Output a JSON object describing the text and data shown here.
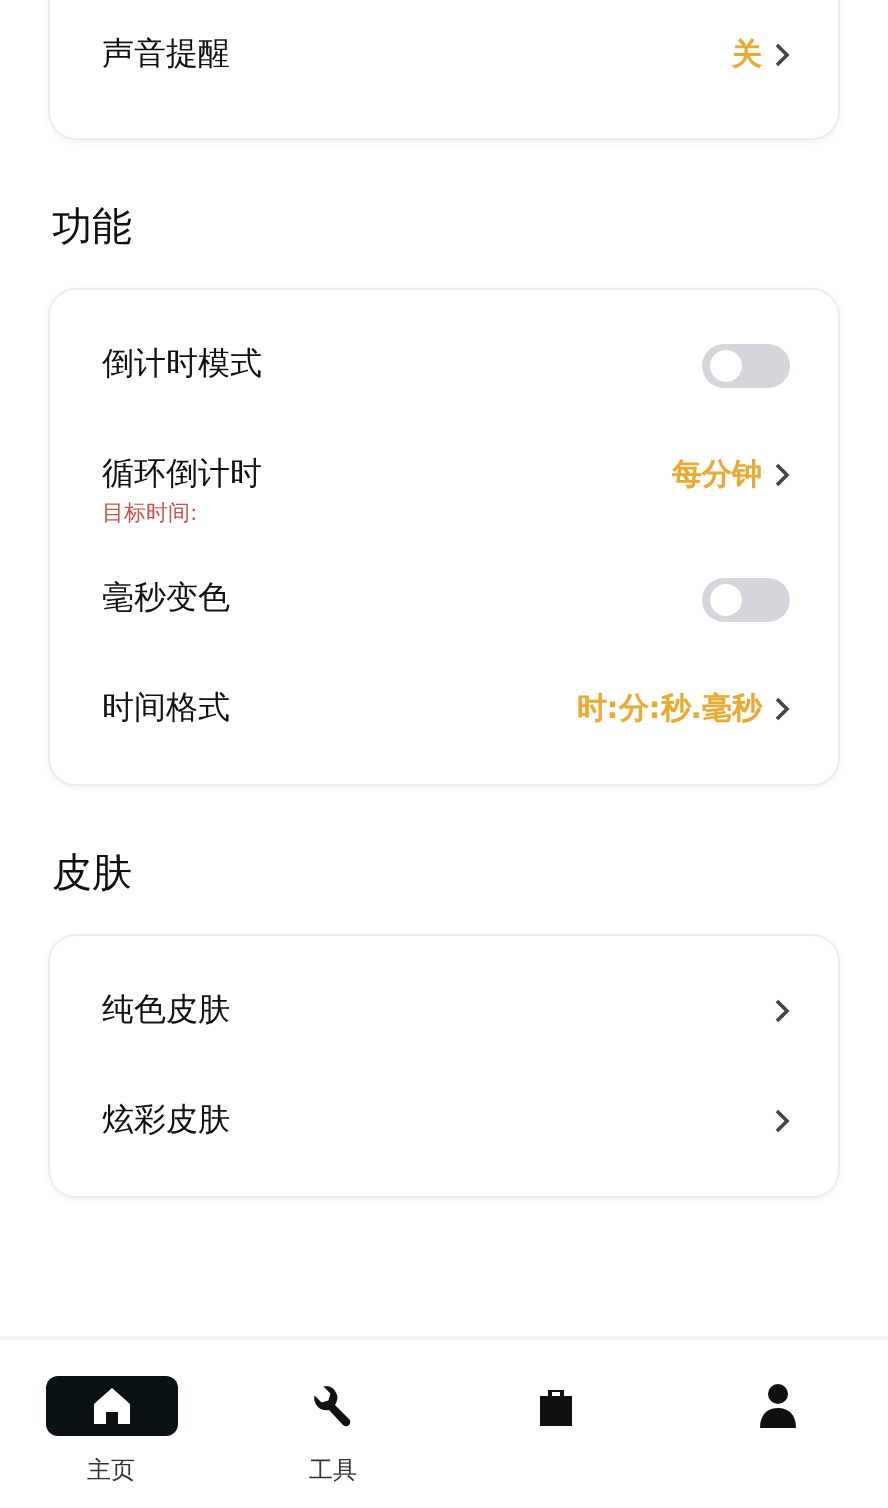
{
  "sections": [
    {
      "rows": [
        {
          "kind": "value",
          "label": "声音提醒",
          "value": "关"
        }
      ]
    },
    {
      "title": "功能",
      "rows": [
        {
          "kind": "toggle",
          "label": "倒计时模式",
          "on": false
        },
        {
          "kind": "value",
          "label": "循环倒计时",
          "value": "每分钟",
          "note": "目标时间:"
        },
        {
          "kind": "toggle",
          "label": "毫秒变色",
          "on": false
        },
        {
          "kind": "value",
          "label": "时间格式",
          "value": "时:分:秒.毫秒"
        }
      ]
    },
    {
      "title": "皮肤",
      "rows": [
        {
          "kind": "link",
          "label": "纯色皮肤"
        },
        {
          "kind": "link",
          "label": "炫彩皮肤"
        }
      ]
    }
  ],
  "nav": [
    {
      "kind": "home",
      "label": "主页",
      "selected": true
    },
    {
      "kind": "tools",
      "label": "工具",
      "selected": false
    },
    {
      "kind": "shop",
      "selected": false
    },
    {
      "kind": "profile",
      "selected": false
    }
  ]
}
